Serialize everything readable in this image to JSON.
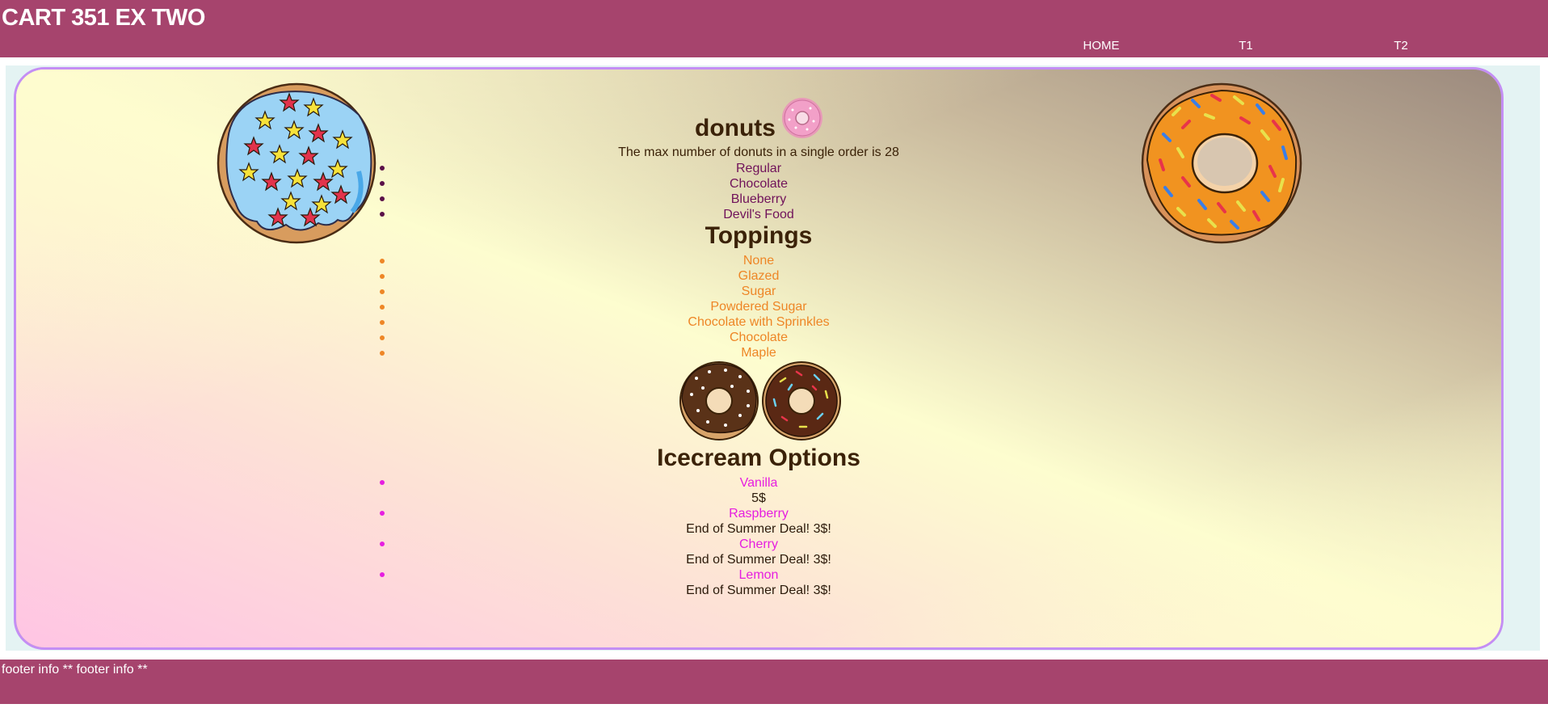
{
  "site": {
    "title": "CART 351 EX TWO"
  },
  "nav": {
    "items": [
      "HOME",
      "T1",
      "T2"
    ]
  },
  "donuts": {
    "heading": "donuts",
    "max_line": "The max number of donuts in a single order is 28",
    "flavors": [
      "Regular",
      "Chocolate",
      "Blueberry",
      "Devil's Food"
    ]
  },
  "toppings": {
    "heading": "Toppings",
    "items": [
      "None",
      "Glazed",
      "Sugar",
      "Powdered Sugar",
      "Chocolate with Sprinkles",
      "Chocolate",
      "Maple"
    ]
  },
  "icecream": {
    "heading": "Icecream Options",
    "items": [
      {
        "name": "Vanilla",
        "price": "5$"
      },
      {
        "name": "Raspberry",
        "price": "End of Summer Deal! 3$!"
      },
      {
        "name": "Cherry",
        "price": "End of Summer Deal! 3$!"
      },
      {
        "name": "Lemon",
        "price": "End of Summer Deal! 3$!"
      }
    ]
  },
  "footer": {
    "text": "footer info ** footer info **"
  },
  "colors": {
    "brand": "#a6446d",
    "heading": "#3b2208",
    "flavor": "#70125a",
    "topping": "#ee8626",
    "icecream": "#e61ee0",
    "panel_border": "#c48ef4"
  },
  "icons": {
    "blue_donut": "blue-star-donut-icon",
    "orange_donut": "orange-sprinkle-donut-icon",
    "pink_donut": "pink-donut-icon",
    "choc_donut_1": "chocolate-dot-donut-icon",
    "choc_donut_2": "chocolate-sprinkle-donut-icon"
  }
}
